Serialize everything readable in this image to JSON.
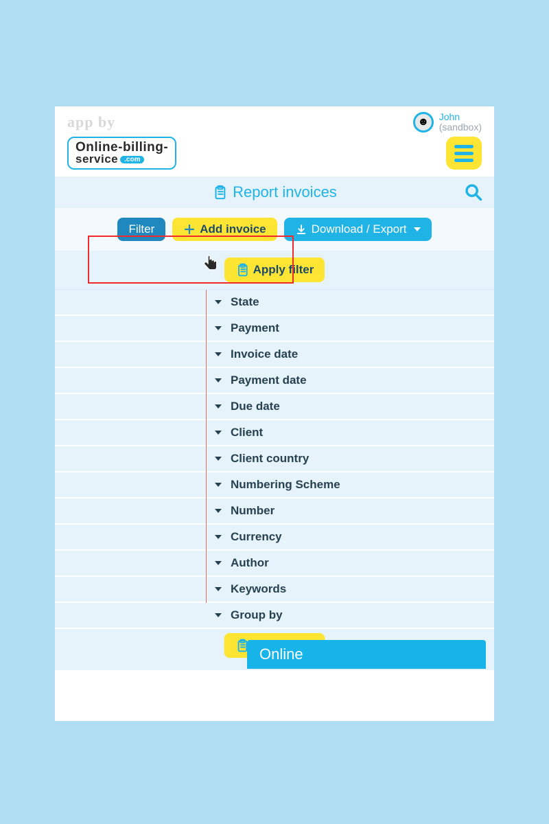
{
  "header": {
    "app_by": "app by",
    "logo_line1": "Online-billing-",
    "logo_line2": "service",
    "logo_pill": ".com",
    "user_name": "John",
    "user_sandbox": "(sandbox)"
  },
  "page": {
    "title": "Report invoices"
  },
  "toolbar": {
    "filter_label": "Filter",
    "add_invoice_label": "Add invoice",
    "download_export_label": "Download / Export"
  },
  "apply_filter": {
    "label": "Apply filter"
  },
  "filters": [
    {
      "label": "State"
    },
    {
      "label": "Payment"
    },
    {
      "label": "Invoice date"
    },
    {
      "label": "Payment date"
    },
    {
      "label": "Due date"
    },
    {
      "label": "Client"
    },
    {
      "label": "Client country"
    },
    {
      "label": "Numbering Scheme"
    },
    {
      "label": "Number"
    },
    {
      "label": "Currency"
    },
    {
      "label": "Author"
    },
    {
      "label": "Keywords"
    },
    {
      "label": "Group by"
    }
  ],
  "bottom": {
    "online_label": "Online"
  }
}
